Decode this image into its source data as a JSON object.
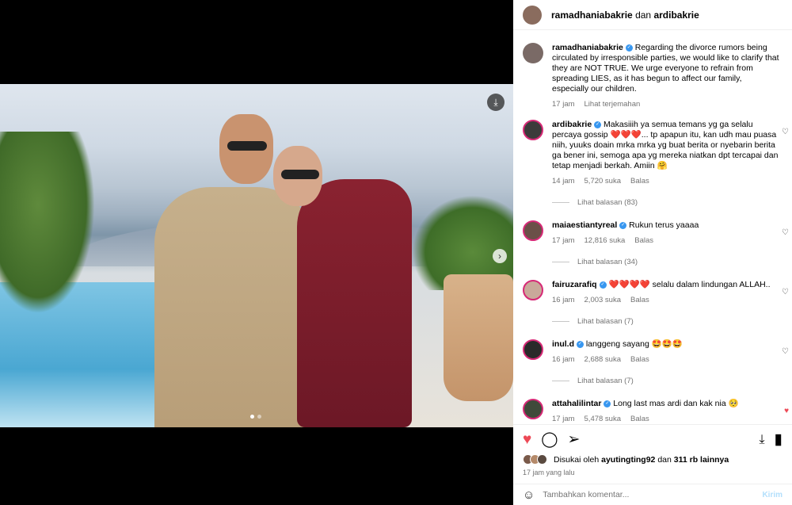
{
  "header": {
    "user1": "ramadhaniabakrie",
    "joiner": "dan",
    "user2": "ardibakrie"
  },
  "caption": {
    "user": "ramadhaniabakrie",
    "text": "Regarding the divorce rumors being circulated by irresponsible parties, we would like to clarify that they are NOT TRUE. We urge everyone to refrain from spreading LIES, as it has begun to affect our family, especially our children.",
    "time": "17 jam",
    "translate": "Lihat terjemahan"
  },
  "comments": [
    {
      "user": "ardibakrie",
      "verified": true,
      "text": "Makasiiih ya semua temans yg ga selalu percaya gossip ❤️❤️❤️... tp apapun itu, kan udh mau puasa niih, yuuks doain mrka mrka yg buat berita or nyebarin berita ga bener ini, semoga apa yg mereka niatkan dpt tercapai dan tetap menjadi berkah. Amiin 🤗",
      "time": "14 jam",
      "likes": "5,720 suka",
      "reply": "Balas",
      "view_replies": "Lihat balasan (83)",
      "liked": false
    },
    {
      "user": "maiaestiantyreal",
      "verified": true,
      "text": "Rukun terus yaaaa",
      "time": "17 jam",
      "likes": "12,816 suka",
      "reply": "Balas",
      "view_replies": "Lihat balasan (34)",
      "liked": false
    },
    {
      "user": "fairuzarafiq",
      "verified": true,
      "text": "❤️❤️❤️❤️ selalu dalam lindungan ALLAH..",
      "time": "16 jam",
      "likes": "2,003 suka",
      "reply": "Balas",
      "view_replies": "Lihat balasan (7)",
      "liked": false
    },
    {
      "user": "inul.d",
      "verified": true,
      "text": "langgeng sayang 🤩🤩🤩",
      "time": "16 jam",
      "likes": "2,688 suka",
      "reply": "Balas",
      "view_replies": "Lihat balasan (7)",
      "liked": false
    },
    {
      "user": "attahalilintar",
      "verified": true,
      "text": "Long last mas ardi dan kak nia 🥺",
      "time": "17 jam",
      "likes": "5,478 suka",
      "reply": "Balas",
      "view_replies": "",
      "liked": true
    }
  ],
  "likes": {
    "prefix": "Disukai oleh",
    "user": "ayutingting92",
    "joiner": "dan",
    "others": "311 rb lainnya"
  },
  "post_time": "17 jam yang lalu",
  "composer": {
    "placeholder": "Tambahkan komentar...",
    "send": "Kirim"
  },
  "icons": {
    "like": "heart-icon",
    "comment": "comment-icon",
    "share": "share-icon",
    "save": "bookmark-icon",
    "download": "download-icon",
    "emoji": "emoji-icon"
  }
}
